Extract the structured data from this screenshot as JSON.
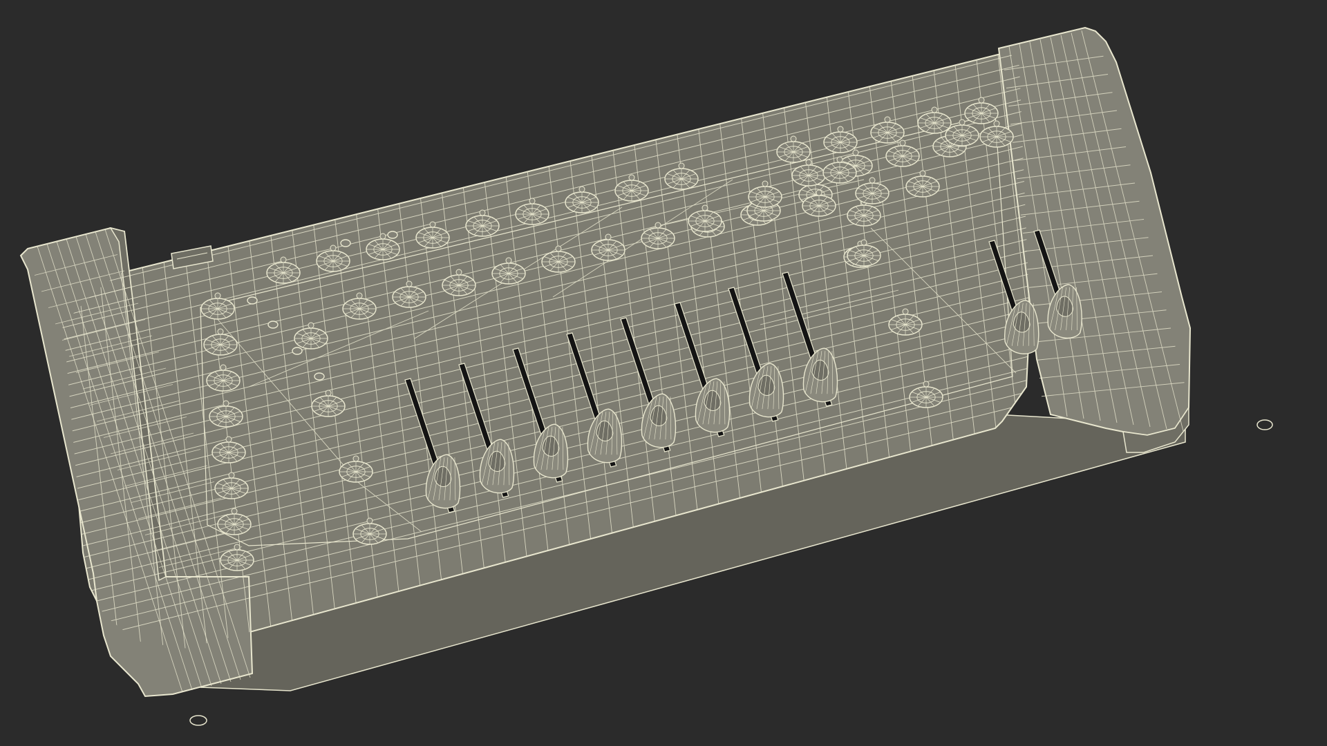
{
  "scene": {
    "subject": "dmx-lighting-controller-wireframe",
    "colors": {
      "background": "#2b2b2b",
      "surface": "#7d7c71",
      "surface_dark": "#6f6e64",
      "surface_side": "#65645b",
      "wire": "#e9e7cf",
      "slot": "#141414",
      "cap": "#8a897d"
    },
    "button_count": 60,
    "fader_count": 10
  }
}
